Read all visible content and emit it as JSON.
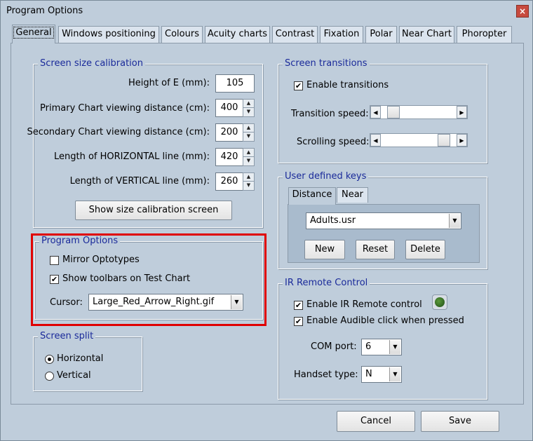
{
  "window": {
    "title": "Program Options",
    "close_glyph": "×"
  },
  "tabs": [
    "General",
    "Windows positioning",
    "Colours",
    "Acuity charts",
    "Contrast",
    "Fixation",
    "Polar",
    "Near Chart",
    "Phoropter"
  ],
  "screen_size": {
    "title": "Screen size calibration",
    "height_label": "Height of E (mm):",
    "height_value": "105",
    "primary_label": "Primary Chart viewing distance (cm):",
    "primary_value": "400",
    "secondary_label": "Secondary Chart viewing distance (cm):",
    "secondary_value": "200",
    "horizontal_label": "Length of HORIZONTAL line (mm):",
    "horizontal_value": "420",
    "vertical_label": "Length of VERTICAL line (mm):",
    "vertical_value": "260",
    "show_button": "Show size calibration screen"
  },
  "program_options": {
    "title": "Program Options",
    "mirror_label": "Mirror Optotypes",
    "mirror_checked": false,
    "toolbars_label": "Show toolbars on Test Chart",
    "toolbars_checked": true,
    "cursor_label": "Cursor:",
    "cursor_value": "Large_Red_Arrow_Right.gif"
  },
  "screen_split": {
    "title": "Screen split",
    "horizontal_label": "Horizontal",
    "vertical_label": "Vertical",
    "selected": "Horizontal"
  },
  "screen_transitions": {
    "title": "Screen transitions",
    "enable_label": "Enable transitions",
    "enable_checked": true,
    "transition_speed_label": "Transition speed:",
    "transition_speed_pos": 0.1,
    "scrolling_speed_label": "Scrolling speed:",
    "scrolling_speed_pos": 0.9
  },
  "user_keys": {
    "title": "User defined keys",
    "tabs": [
      "Distance",
      "Near"
    ],
    "file_value": "Adults.usr",
    "new_label": "New",
    "reset_label": "Reset",
    "delete_label": "Delete"
  },
  "ir_remote": {
    "title": "IR Remote Control",
    "enable_label": "Enable IR Remote control",
    "enable_checked": true,
    "audible_label": "Enable Audible click when pressed",
    "audible_checked": true,
    "com_label": "COM port:",
    "com_value": "6",
    "handset_label": "Handset type:",
    "handset_value": "N"
  },
  "footer": {
    "cancel_label": "Cancel",
    "save_label": "Save"
  },
  "glyphs": {
    "check": "✔",
    "up": "▲",
    "down": "▼",
    "left": "◀",
    "right": "▶"
  },
  "colors": {
    "group_title": "#1a2a9a",
    "highlight": "#e00000",
    "background": "#bfcddb"
  }
}
